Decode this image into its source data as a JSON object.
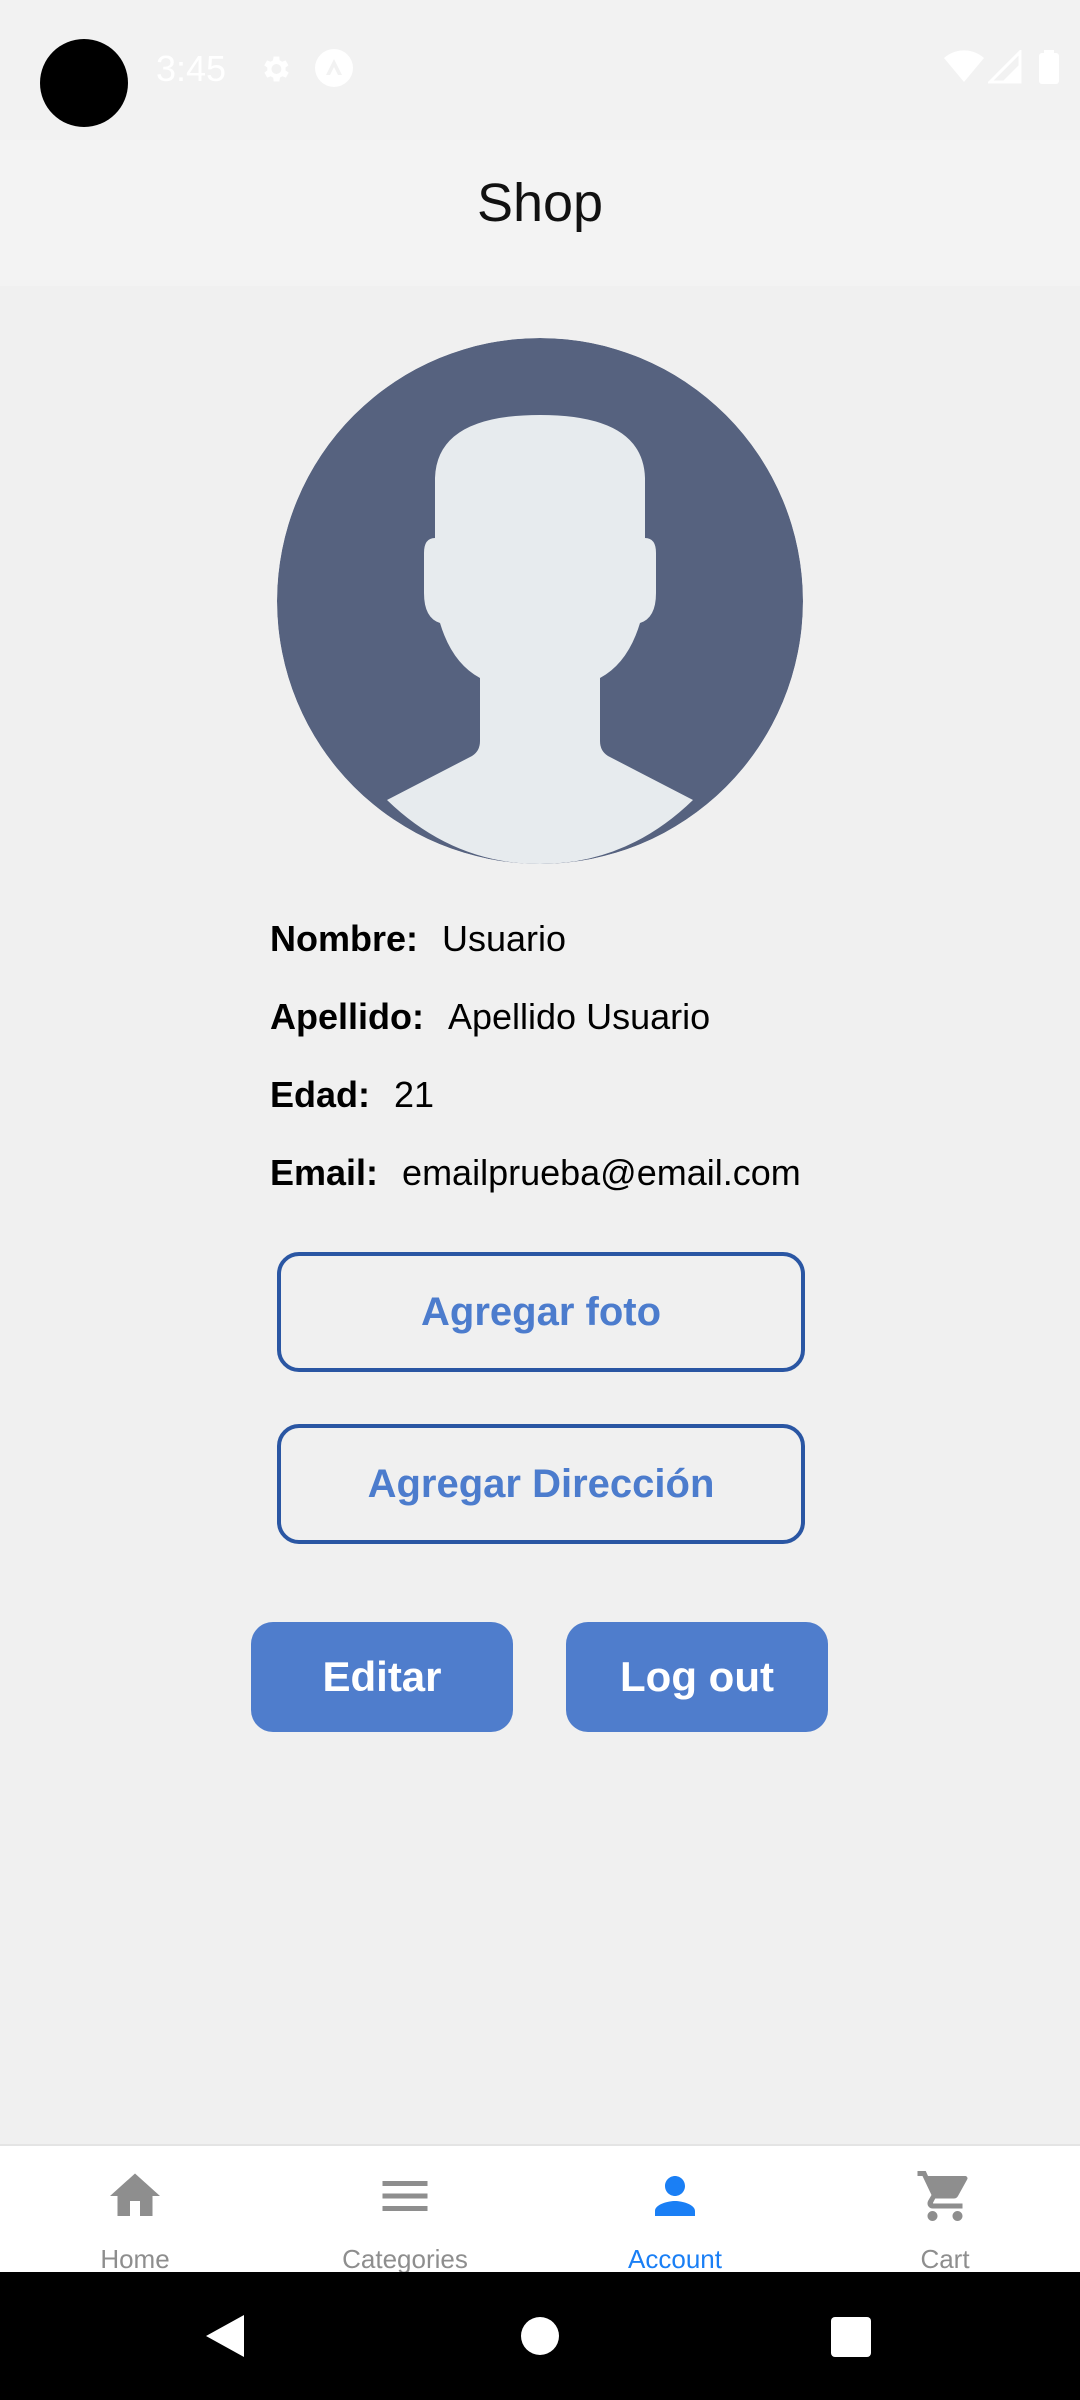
{
  "status_bar": {
    "time": "3:45",
    "icons": [
      "settings-icon",
      "app-notification-icon",
      "wifi-icon",
      "signal-icon",
      "battery-icon"
    ]
  },
  "header": {
    "title": "Shop"
  },
  "profile": {
    "fields": [
      {
        "label": "Nombre:",
        "value": "Usuario"
      },
      {
        "label": "Apellido:",
        "value": "Apellido Usuario"
      },
      {
        "label": "Edad:",
        "value": "21"
      },
      {
        "label": "Email:",
        "value": "emailprueba@email.com"
      }
    ]
  },
  "actions": {
    "add_photo": "Agregar foto",
    "add_address": "Agregar Dirección",
    "edit": "Editar",
    "logout": "Log out"
  },
  "tabs": [
    {
      "label": "Home",
      "icon": "home-icon",
      "active": false
    },
    {
      "label": "Categories",
      "icon": "menu-icon",
      "active": false
    },
    {
      "label": "Account",
      "icon": "person-icon",
      "active": true
    },
    {
      "label": "Cart",
      "icon": "cart-icon",
      "active": false
    }
  ],
  "colors": {
    "accent": "#4f7dcc",
    "outline": "#2a56a3",
    "active_tab": "#1a7ff5",
    "avatar_bg": "#56627f",
    "avatar_fg": "#e7ebee"
  }
}
